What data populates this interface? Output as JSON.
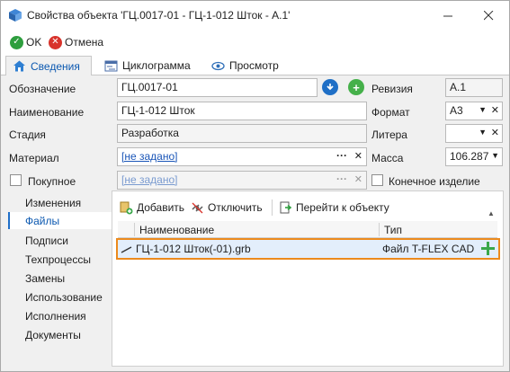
{
  "window": {
    "title": "Свойства объекта 'ГЦ.0017-01 - ГЦ-1-012 Шток - А.1'"
  },
  "toolbar": {
    "ok_label": "OK",
    "cancel_label": "Отмена"
  },
  "tabs": [
    {
      "label": "Сведения"
    },
    {
      "label": "Циклограмма"
    },
    {
      "label": "Просмотр"
    }
  ],
  "form": {
    "designation_label": "Обозначение",
    "designation_value": "ГЦ.0017-01",
    "name_label": "Наименование",
    "name_value": "ГЦ-1-012 Шток",
    "stage_label": "Стадия",
    "stage_value": "Разработка",
    "material_label": "Материал",
    "material_value": "[не задано]",
    "purchased_label": "Покупное",
    "purchased_value": "[не задано]",
    "revision_label": "Ревизия",
    "revision_value": "А.1",
    "format_label": "Формат",
    "format_value": "А3",
    "litera_label": "Литера",
    "litera_value": "",
    "mass_label": "Масса",
    "mass_value": "106.287",
    "final_product_label": "Конечное изделие",
    "dots": "···"
  },
  "sidebar": {
    "items": [
      {
        "label": "Изменения"
      },
      {
        "label": "Файлы"
      },
      {
        "label": "Подписи"
      },
      {
        "label": "Техпроцессы"
      },
      {
        "label": "Замены"
      },
      {
        "label": "Использование"
      },
      {
        "label": "Исполнения"
      },
      {
        "label": "Документы"
      }
    ],
    "active_index": 1
  },
  "files_panel": {
    "add_label": "Добавить",
    "detach_label": "Отключить",
    "goto_label": "Перейти к объекту",
    "col_name": "Наименование",
    "col_type": "Тип",
    "rows": [
      {
        "name": "ГЦ-1-012 Шток(-01).grb",
        "type": "Файл T-FLEX CAD"
      }
    ]
  },
  "colors": {
    "accent": "#1e6ec8",
    "ok_green": "#2e9e3e",
    "cancel_red": "#d8332b",
    "highlight_orange": "#ec8a1d"
  }
}
